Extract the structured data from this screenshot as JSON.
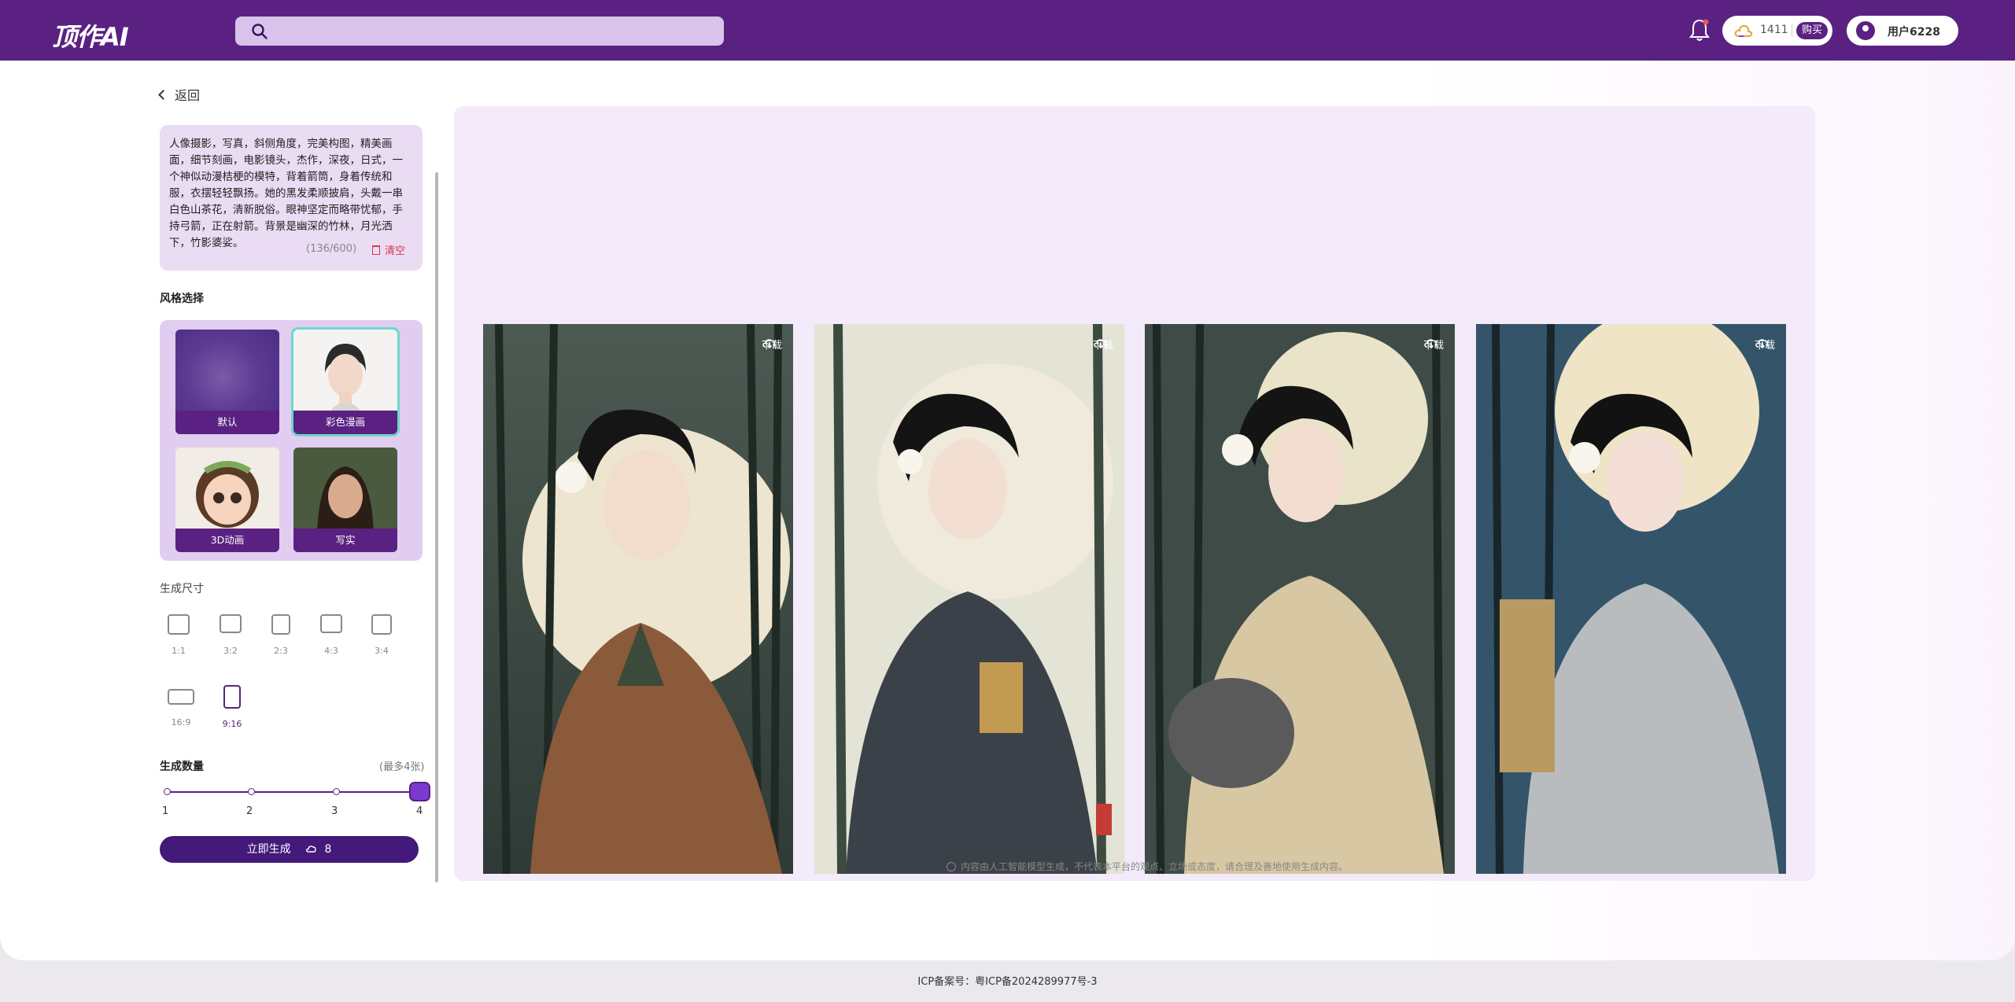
{
  "header": {
    "logo": "顶作AI",
    "search_placeholder": "",
    "credits": "1411",
    "buy_label": "购买",
    "username": "用户6228"
  },
  "nav": {
    "back_label": "返回"
  },
  "prompt": {
    "text": "人像摄影，写真，斜侧角度，完美构图，精美画面，细节刻画，电影镜头，杰作，深夜，日式，一个神似动漫桔梗的模特，背着箭筒，身着传统和服，衣摆轻轻飘扬。她的黑发柔顺披肩，头戴一串白色山茶花，清新脱俗。眼神坚定而略带忧郁，手持弓箭，正在射箭。背景是幽深的竹林，月光洒下，竹影婆娑。",
    "count": "(136/600)",
    "clear_label": "清空"
  },
  "style": {
    "title": "风格选择",
    "options": [
      {
        "label": "默认",
        "selected": false
      },
      {
        "label": "彩色漫画",
        "selected": true
      },
      {
        "label": "3D动画",
        "selected": false
      },
      {
        "label": "写实",
        "selected": false
      }
    ]
  },
  "size": {
    "title": "生成尺寸",
    "options": [
      {
        "label": "1:1",
        "active": false
      },
      {
        "label": "3:2",
        "active": false
      },
      {
        "label": "2:3",
        "active": false
      },
      {
        "label": "4:3",
        "active": false
      },
      {
        "label": "3:4",
        "active": false
      },
      {
        "label": "16:9",
        "active": false
      },
      {
        "label": "9:16",
        "active": true
      }
    ]
  },
  "quantity": {
    "title": "生成数量",
    "hint": "(最多4张)",
    "ticks": [
      "1",
      "2",
      "3",
      "4"
    ],
    "value": 4
  },
  "generate": {
    "label": "立即生成",
    "cost": "8"
  },
  "gallery": {
    "images": [
      {
        "download_label": "下载"
      },
      {
        "download_label": "下载"
      },
      {
        "download_label": "下载"
      },
      {
        "download_label": "下载"
      }
    ],
    "disclaimer": "内容由人工智能模型生成，不代表本平台的观点、立场或态度，请合理及善地使用生成内容。"
  },
  "footer": {
    "icp": "ICP备案号：粤ICP备2024289977号-3"
  },
  "colors": {
    "brand": "#5a2182",
    "accent": "#6ed7c9",
    "danger": "#d9364a"
  }
}
